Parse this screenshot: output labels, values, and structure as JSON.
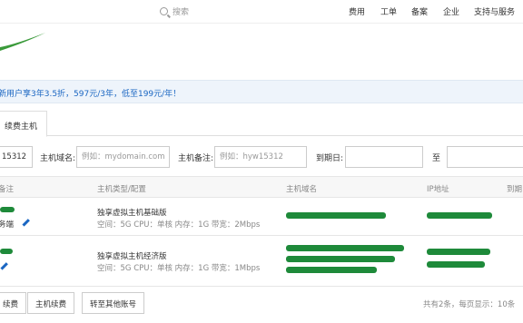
{
  "header": {
    "search_placeholder": "搜索",
    "nav": [
      "费用",
      "工单",
      "备案",
      "企业",
      "支持与服务"
    ]
  },
  "promo": {
    "text": "新用户享3年3.5折，597元/3年，低至199元/年！"
  },
  "tabs": {
    "active": "续费主机"
  },
  "filter": {
    "id_value": "15312",
    "domain_label": "主机域名:",
    "domain_placeholder": "例如：mydomain.com",
    "note_label": "主机备注:",
    "note_placeholder": "例如：hyw15312",
    "expiry_label": "到期日:",
    "to_label": "至"
  },
  "table": {
    "headers": [
      "备注",
      "主机类型/配置",
      "主机域名",
      "IP地址",
      "到期"
    ],
    "rows": [
      {
        "note": "务端",
        "type": "独享虚拟主机基础版",
        "spec": "空间：5G CPU：单核 内存：1G 带宽：2Mbps"
      },
      {
        "note": "",
        "type": "独享虚拟主机经济版",
        "spec": "空间：5G CPU：单核 内存：1G 带宽：1Mbps"
      }
    ]
  },
  "footer": {
    "buttons": [
      "续费",
      "主机续费",
      "转至其他账号"
    ],
    "page_info": "共有2条，每页显示：10条"
  },
  "colors": {
    "accent": "#1a66c2",
    "redaction": "#1e8a3a"
  }
}
